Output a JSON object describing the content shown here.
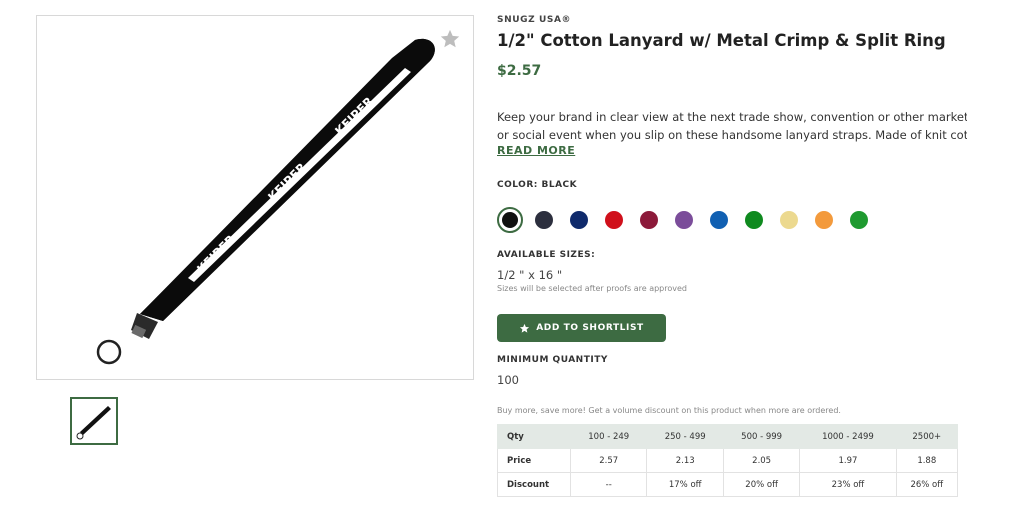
{
  "product": {
    "brand": "SNUGZ USA®",
    "title": "1/2\" Cotton Lanyard w/ Metal Crimp & Split Ring",
    "price": "$2.57",
    "description_line1": "Keep your brand in clear view at the next trade show, convention or other marketing",
    "description_line2": "or social event when you slip on these handsome lanyard straps. Made of knit cotto...",
    "read_more": "READ MORE",
    "imprint_text": "KEIPER"
  },
  "color": {
    "label": "COLOR: BLACK",
    "swatches": [
      "#111111",
      "#2c2f3e",
      "#0f2a6b",
      "#d0101b",
      "#8c1a3a",
      "#7b4d9a",
      "#1160b2",
      "#0f8a1f",
      "#ecd98f",
      "#f39a3c",
      "#1f9a30"
    ],
    "selected_index": 0
  },
  "sizes": {
    "label": "AVAILABLE SIZES:",
    "value": "1/2 \" x 16 \"",
    "note": "Sizes will be selected after proofs are approved"
  },
  "shortlist": {
    "label": "ADD TO SHORTLIST",
    "icon": "star-icon"
  },
  "minimum": {
    "label": "MINIMUM QUANTITY",
    "value": "100"
  },
  "volume_note": "Buy more, save more! Get a volume discount on this product when more are ordered.",
  "pricing": {
    "headers": [
      "Qty",
      "100 - 249",
      "250 - 499",
      "500 - 999",
      "1000 - 2499",
      "2500+"
    ],
    "price_row": [
      "Price",
      "2.57",
      "2.13",
      "2.05",
      "1.97",
      "1.88"
    ],
    "discount_row": [
      "Discount",
      "--",
      "17% off",
      "20% off",
      "23% off",
      "26% off"
    ]
  },
  "colors": {
    "accent": "#3d6b42",
    "favorite_star": "#bdbdbd"
  }
}
